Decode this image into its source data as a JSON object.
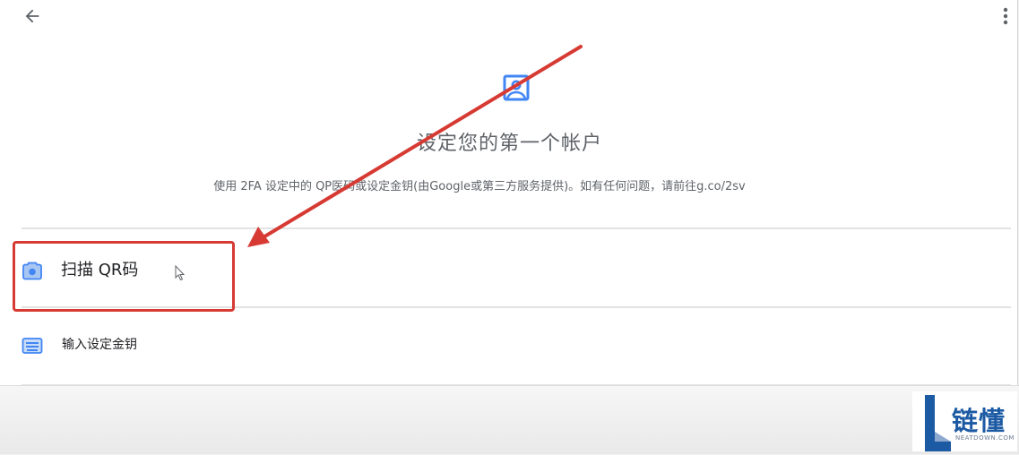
{
  "header": {
    "back_icon": "arrow-left-icon",
    "more_icon": "more-vert-icon"
  },
  "main": {
    "icon": "account-box-icon",
    "title": "设定您的第一个帐户",
    "description": "使用 2FA 设定中的 QP医码或设定金钥(由Google或第三方服务提供)。如有任何问题，请前往g.co/2sv"
  },
  "options": [
    {
      "label": "扫描 QR码",
      "icon": "camera-icon"
    },
    {
      "label": "输入设定金钥",
      "icon": "keyboard-icon"
    }
  ],
  "watermark": {
    "brand": "链懂",
    "domain": "NEATDOWN.COM"
  },
  "colors": {
    "accent": "#4285f4",
    "highlight": "#d63a33",
    "text_primary": "#202124",
    "text_secondary": "#5f6368"
  }
}
